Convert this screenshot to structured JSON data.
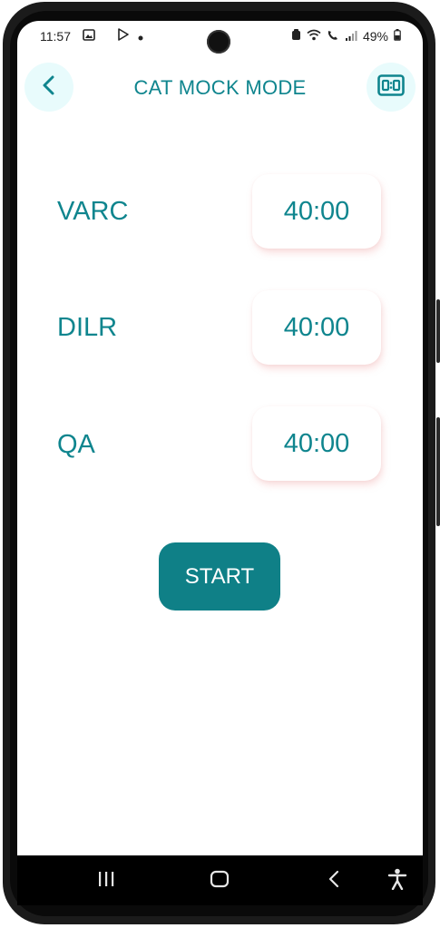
{
  "status_bar": {
    "time": "11:57",
    "battery": "49%"
  },
  "header": {
    "title": "CAT MOCK MODE",
    "back_icon": "chevron-left-icon",
    "mode_icon": "scoreboard-icon"
  },
  "sections": [
    {
      "label": "VARC",
      "time": "40:00"
    },
    {
      "label": "DILR",
      "time": "40:00"
    },
    {
      "label": "QA",
      "time": "40:00"
    }
  ],
  "start_label": "START",
  "colors": {
    "accent": "#0f858e",
    "button": "#0f8087",
    "icon_bg": "#e8fbfc"
  },
  "nav_bar": {
    "items": [
      "recent-apps-icon",
      "home-icon",
      "back-icon",
      "accessibility-icon"
    ]
  }
}
